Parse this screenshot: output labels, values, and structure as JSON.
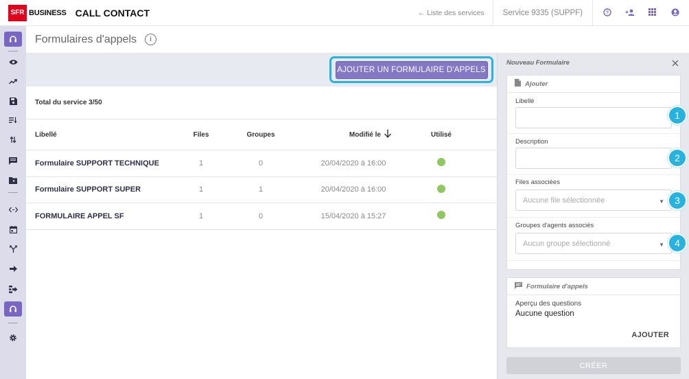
{
  "header": {
    "logo_text": "SFR",
    "brand": "BUSINESS",
    "app_title": "CALL CONTACT",
    "back_link": "← Liste des services",
    "service": "Service 9335 (SUPPF)",
    "icons": [
      "help-icon",
      "add-user-icon",
      "apps-grid-icon",
      "account-icon"
    ]
  },
  "page": {
    "title": "Formulaires d'appels"
  },
  "toolbar": {
    "add_button": "AJOUTER UN FORMULAIRE D'APPELS"
  },
  "summary": {
    "total": "Total du service 3/50"
  },
  "table": {
    "columns": [
      "Libellé",
      "Files",
      "Groupes",
      "Modifié le",
      "Utilisé"
    ],
    "rows": [
      {
        "libelle": "Formulaire SUPPORT TECHNIQUE",
        "files": "1",
        "groupes": "0",
        "modifie": "20/04/2020 à 16:00",
        "utilise": true
      },
      {
        "libelle": "Formulaire SUPPORT SUPER",
        "files": "1",
        "groupes": "1",
        "modifie": "20/04/2020 à 16:00",
        "utilise": true
      },
      {
        "libelle": "FORMULAIRE APPEL SF",
        "files": "1",
        "groupes": "0",
        "modifie": "15/04/2020 à 15:27",
        "utilise": true
      }
    ]
  },
  "panel": {
    "title": "Nouveau Formulaire",
    "form_card": {
      "heading": "Ajouter",
      "fields": [
        {
          "label": "Libellé",
          "value": "",
          "badge": "1"
        },
        {
          "label": "Description",
          "value": "",
          "badge": "2"
        },
        {
          "label": "Files associées",
          "placeholder": "Aucune file sélectionnée",
          "badge": "3"
        },
        {
          "label": "Groupes d'agents associés",
          "placeholder": "Aucun groupe sélectionné",
          "badge": "4"
        }
      ]
    },
    "questions_card": {
      "heading": "Formulaire d'appels",
      "preview_label": "Aperçu des questions",
      "preview_value": "Aucune question",
      "add_link": "AJOUTER"
    },
    "create_button": "CRÉER"
  },
  "colors": {
    "accent": "#7866c2",
    "highlight": "#27b3e0",
    "status_ok": "#8ec85e",
    "brand_red": "#e2001a"
  }
}
